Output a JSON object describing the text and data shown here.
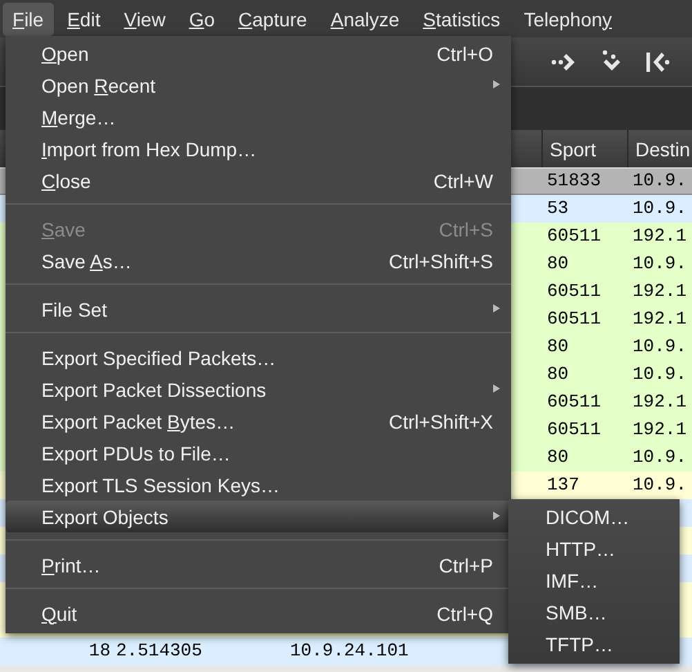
{
  "menubar": [
    {
      "key": "F",
      "after": "ile",
      "selected": true
    },
    {
      "key": "E",
      "after": "dit",
      "selected": false
    },
    {
      "key": "V",
      "after": "iew",
      "selected": false
    },
    {
      "key": "G",
      "after": "o",
      "selected": false
    },
    {
      "key": "C",
      "after": "apture",
      "selected": false
    },
    {
      "key": "A",
      "after": "nalyze",
      "selected": false
    },
    {
      "key": "S",
      "after": "tatistics",
      "selected": false
    },
    {
      "before": "Telephon",
      "key": "y",
      "selected": false
    }
  ],
  "file_menu": [
    {
      "kind": "item",
      "key": "O",
      "after": "pen",
      "shortcut": "Ctrl+O",
      "submenu": false,
      "disabled": false,
      "selected": false
    },
    {
      "kind": "item",
      "before": "Open ",
      "key": "R",
      "after": "ecent",
      "submenu": true,
      "disabled": false,
      "selected": false
    },
    {
      "kind": "item",
      "key": "M",
      "after": "erge…",
      "submenu": false,
      "disabled": false,
      "selected": false
    },
    {
      "kind": "item",
      "key": "I",
      "after": "mport from Hex Dump…",
      "submenu": false,
      "disabled": false,
      "selected": false
    },
    {
      "kind": "item",
      "key": "C",
      "after": "lose",
      "shortcut": "Ctrl+W",
      "submenu": false,
      "disabled": false,
      "selected": false
    },
    {
      "kind": "separator"
    },
    {
      "kind": "item",
      "key": "S",
      "after": "ave",
      "shortcut": "Ctrl+S",
      "submenu": false,
      "disabled": true,
      "selected": false
    },
    {
      "kind": "item",
      "before": "Save ",
      "key": "A",
      "after": "s…",
      "shortcut": "Ctrl+Shift+S",
      "submenu": false,
      "disabled": false,
      "selected": false
    },
    {
      "kind": "separator"
    },
    {
      "kind": "item",
      "before": "File Set",
      "submenu": true,
      "disabled": false,
      "selected": false
    },
    {
      "kind": "separator"
    },
    {
      "kind": "item",
      "before": "Export Specified Packets…",
      "submenu": false,
      "disabled": false,
      "selected": false
    },
    {
      "kind": "item",
      "before": "Export Packet Dissections",
      "submenu": true,
      "disabled": false,
      "selected": false
    },
    {
      "kind": "item",
      "before": "Export Packet ",
      "key": "B",
      "after": "ytes…",
      "shortcut": "Ctrl+Shift+X",
      "submenu": false,
      "disabled": false,
      "selected": false
    },
    {
      "kind": "item",
      "before": "Export PDUs to File…",
      "submenu": false,
      "disabled": false,
      "selected": false
    },
    {
      "kind": "item",
      "before": "Export TLS Session Keys…",
      "submenu": false,
      "disabled": false,
      "selected": false
    },
    {
      "kind": "item",
      "before": "Export Objects",
      "submenu": true,
      "disabled": false,
      "selected": true
    },
    {
      "kind": "separator"
    },
    {
      "kind": "item",
      "key": "P",
      "after": "rint…",
      "shortcut": "Ctrl+P",
      "submenu": false,
      "disabled": false,
      "selected": false
    },
    {
      "kind": "separator"
    },
    {
      "kind": "item",
      "key": "Q",
      "after": "uit",
      "shortcut": "Ctrl+Q",
      "submenu": false,
      "disabled": false,
      "selected": false
    }
  ],
  "export_objects_submenu": [
    "DICOM…",
    "HTTP…",
    "IMF…",
    "SMB…",
    "TFTP…"
  ],
  "packet_list": {
    "columns": [
      "Sport",
      "Destin"
    ],
    "rows": [
      {
        "sport": "51833",
        "destination": "10.9.",
        "color": "#b4b4b4",
        "selected": true
      },
      {
        "sport": "53",
        "destination": "10.9.",
        "color": "#daeeff",
        "selected": false
      },
      {
        "sport": "60511",
        "destination": "192.1",
        "color": "#e4ffc7",
        "selected": false
      },
      {
        "sport": "80",
        "destination": "10.9.",
        "color": "#e4ffc7",
        "selected": false
      },
      {
        "sport": "60511",
        "destination": "192.1",
        "color": "#e4ffc7",
        "selected": false
      },
      {
        "sport": "60511",
        "destination": "192.1",
        "color": "#e4ffc7",
        "selected": false
      },
      {
        "sport": "80",
        "destination": "10.9.",
        "color": "#e4ffc7",
        "selected": false
      },
      {
        "sport": "80",
        "destination": "10.9.",
        "color": "#e4ffc7",
        "selected": false
      },
      {
        "sport": "60511",
        "destination": "192.1",
        "color": "#e4ffc7",
        "selected": false
      },
      {
        "sport": "60511",
        "destination": "192.1",
        "color": "#e4ffc7",
        "selected": false
      },
      {
        "sport": "80",
        "destination": "10.9.",
        "color": "#e4ffc7",
        "selected": false
      },
      {
        "sport": "137",
        "destination": "10.9.",
        "color": "#ffffd5",
        "selected": false
      },
      {
        "color": "#daeeff",
        "selected": false
      },
      {
        "color": "#ffffd5",
        "selected": false
      },
      {
        "color": "#daeeff",
        "selected": false
      },
      {
        "color": "#ffffd5",
        "selected": false
      },
      {
        "color": "#ffffd5",
        "selected": false
      },
      {
        "no": "18",
        "time": "2.514305",
        "source": "10.9.24.101",
        "color": "#daeeff",
        "selected": false
      }
    ]
  }
}
